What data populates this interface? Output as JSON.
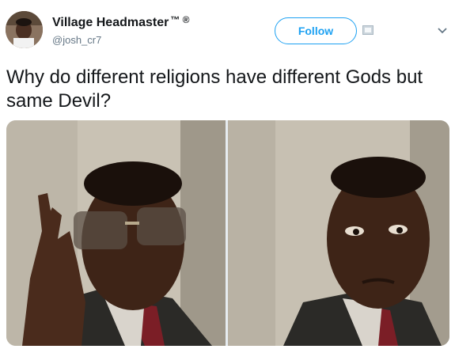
{
  "user": {
    "display_name": "Village Headmaster",
    "badges": "™ ®",
    "handle": "@josh_cr7"
  },
  "actions": {
    "follow_label": "Follow"
  },
  "tweet": {
    "text": "Why do different religions have different Gods but same Devil?"
  },
  "icons": {
    "dm": "mail-icon",
    "menu": "chevron-down-icon"
  },
  "colors": {
    "accent": "#1da1f2",
    "text": "#14171a",
    "secondary": "#657786"
  }
}
